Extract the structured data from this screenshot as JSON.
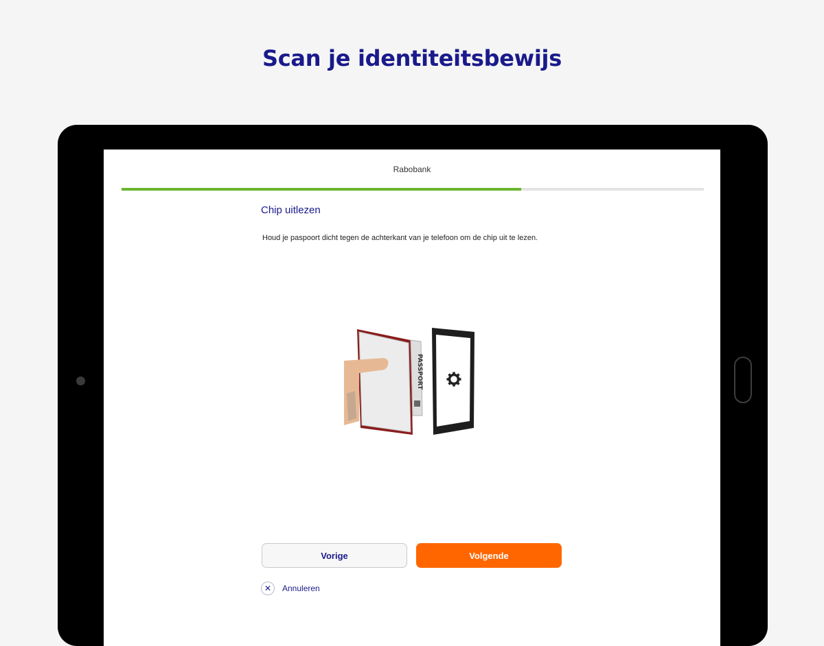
{
  "headline": "Scan je identiteitsbewijs",
  "app": {
    "title": "Rabobank"
  },
  "progress": {
    "fraction": 0.686,
    "fill_color": "#6bb52e",
    "track_color": "#e3e3e3"
  },
  "step": {
    "title": "Chip uitlezen",
    "instruction": "Houd je paspoort dicht tegen de achterkant van je telefoon om de chip uit te lezen."
  },
  "illustration": {
    "passport_spine_text": "PASSPORT",
    "phone_icon": "gear-icon"
  },
  "buttons": {
    "previous": "Vorige",
    "next": "Volgende",
    "cancel": "Annuleren",
    "cancel_icon": "close-icon",
    "next_color": "#ff6600"
  },
  "colors": {
    "brand_text": "#1a1a8c",
    "background": "#f5f5f5",
    "device": "#000000"
  }
}
